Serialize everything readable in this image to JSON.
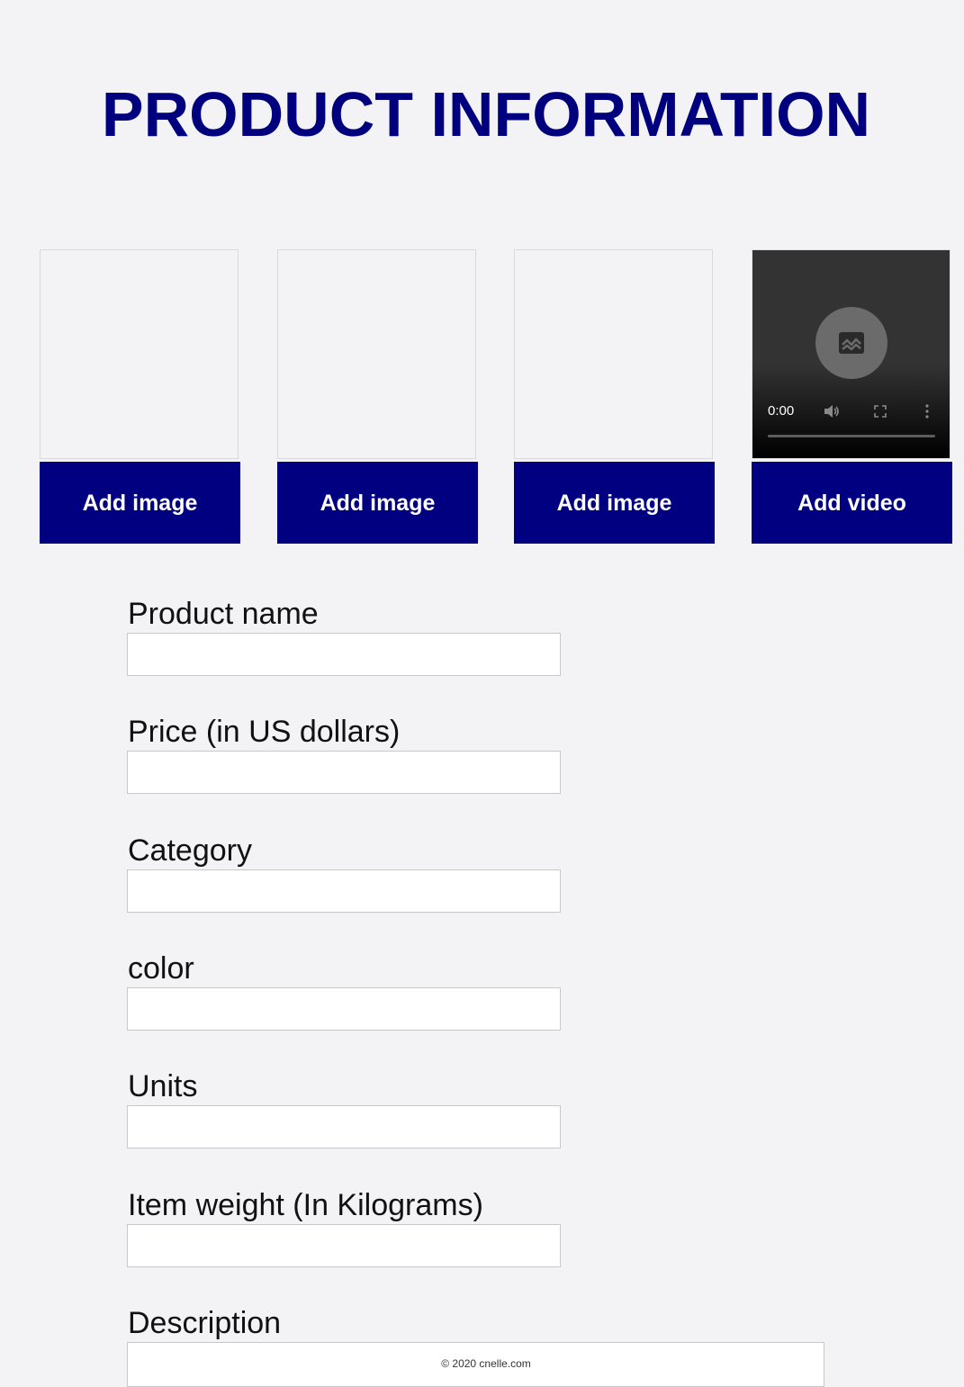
{
  "header": {
    "title": "PRODUCT INFORMATION"
  },
  "media": {
    "image_slots": [
      {
        "button_label": "Add image"
      },
      {
        "button_label": "Add image"
      },
      {
        "button_label": "Add image"
      }
    ],
    "video": {
      "time": "0:00",
      "progress": 0,
      "button_label": "Add video",
      "icons": [
        "broken-image-icon",
        "volume-icon",
        "fullscreen-icon",
        "more-options-icon"
      ]
    }
  },
  "form": {
    "product_name": {
      "label": "Product name",
      "value": ""
    },
    "price": {
      "label": "Price (in US dollars)",
      "value": ""
    },
    "category": {
      "label": "Category",
      "value": ""
    },
    "color": {
      "label": "color",
      "value": ""
    },
    "units": {
      "label": "Units",
      "value": ""
    },
    "item_weight": {
      "label": "Item weight (In Kilograms)",
      "value": ""
    },
    "description": {
      "label": "Description",
      "value": ""
    }
  },
  "footer": {
    "text": "© 2020 cnelle.com"
  },
  "colors": {
    "accent": "#000080",
    "background": "#f3f3f6",
    "title": "#00007f"
  }
}
